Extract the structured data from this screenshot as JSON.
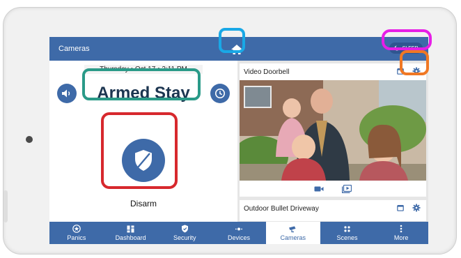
{
  "header": {
    "title": "Cameras",
    "home_icon": "home-icon",
    "sleep_label": "SLEEP"
  },
  "status": {
    "date_time": "Thursday • Oct 17 • 2:11 PM",
    "arming_state": "Armed Stay",
    "disarm_label": "Disarm"
  },
  "cameras": [
    {
      "name": "Video Doorbell"
    },
    {
      "name": "Outdoor Bullet Driveway"
    }
  ],
  "nav": {
    "items": [
      {
        "label": "Panics",
        "icon": "panic-star-icon"
      },
      {
        "label": "Dashboard",
        "icon": "dashboard-grid-icon"
      },
      {
        "label": "Security",
        "icon": "security-shield-icon"
      },
      {
        "label": "Devices",
        "icon": "devices-icon"
      },
      {
        "label": "Cameras",
        "icon": "camera-icon"
      },
      {
        "label": "Scenes",
        "icon": "scenes-icon"
      },
      {
        "label": "More",
        "icon": "more-dots-icon"
      }
    ],
    "active": "Cameras"
  },
  "colors": {
    "brand_blue": "#3e6aa8",
    "highlight_home": "#19a8e6",
    "highlight_sleep": "#e61ee6",
    "highlight_armed": "#2a9a88",
    "highlight_disarm": "#d7282d",
    "highlight_gear": "#f07824"
  }
}
